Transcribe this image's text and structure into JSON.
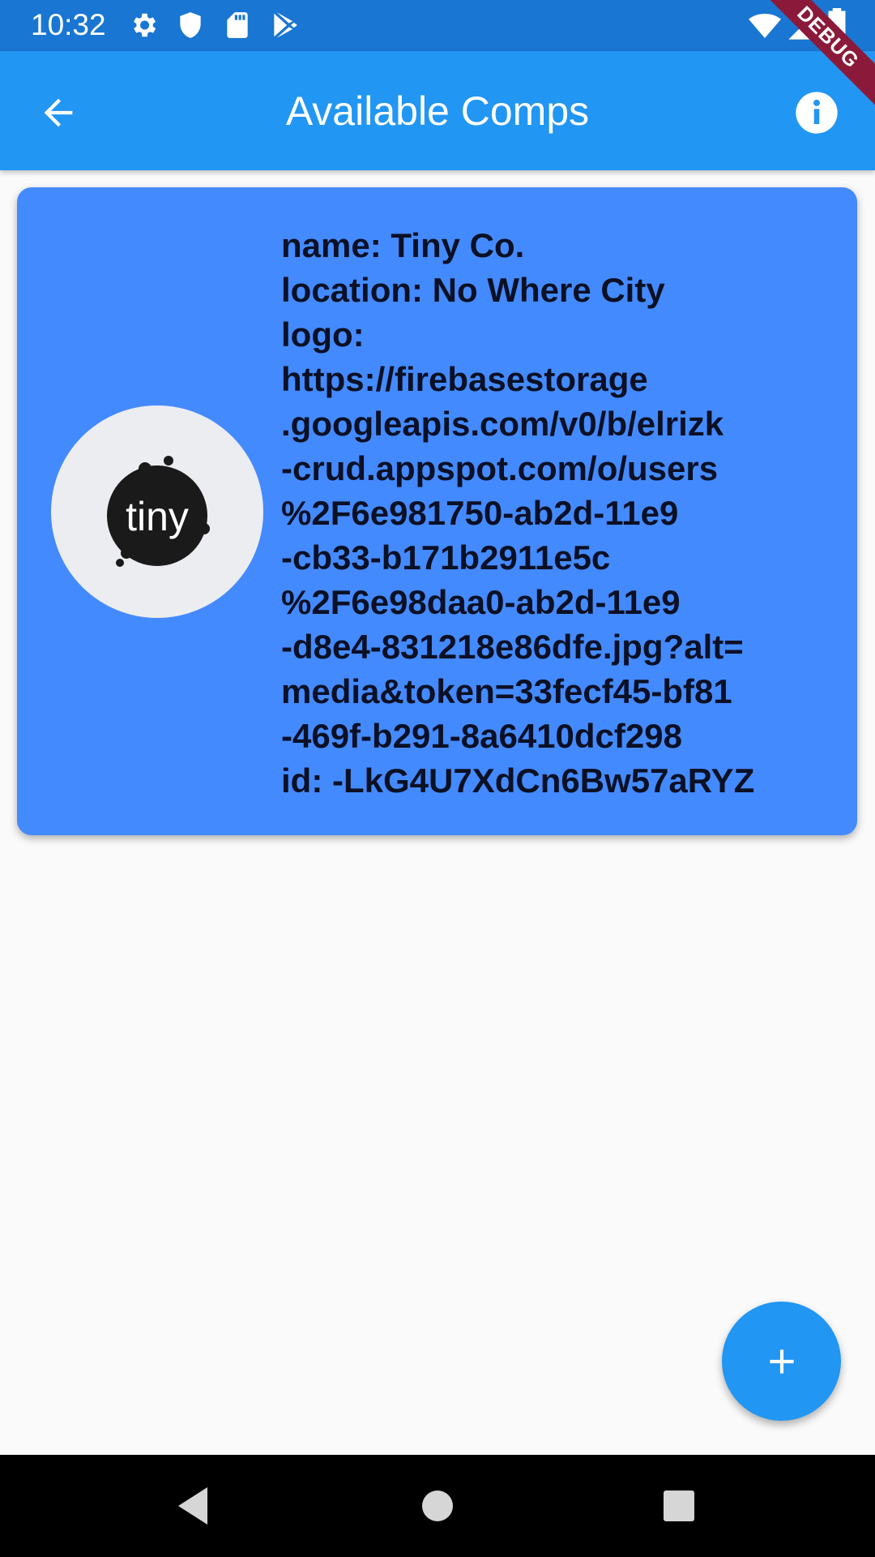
{
  "status_bar": {
    "time": "10:32",
    "icons": [
      "gear-icon",
      "shield-icon",
      "sd-card-icon",
      "play-store-icon",
      "wifi-icon",
      "signal-icon",
      "battery-icon"
    ]
  },
  "app_bar": {
    "title": "Available Comps",
    "back_icon": "arrow-back-icon",
    "info_icon": "info-icon",
    "color": "#2196f3"
  },
  "debug_banner": {
    "label": "DEBUG"
  },
  "card": {
    "color": "#448aff",
    "logo_text": "tiny",
    "lines": [
      "name: Tiny Co.",
      "location: No Where City",
      "logo:",
      "https://firebasestorage",
      ".googleapis.com/v0/b/elrizk",
      "-crud.appspot.com/o/users",
      "%2F6e981750-ab2d-11e9",
      "-cb33-b171b2911e5c",
      "%2F6e98daa0-ab2d-11e9",
      "-d8e4-831218e86dfe.jpg?alt=",
      "media&token=33fecf45-bf81",
      "-469f-b291-8a6410dcf298",
      "id: -LkG4U7XdCn6Bw57aRYZ"
    ]
  },
  "fab": {
    "icon": "add-icon",
    "color": "#2196f3"
  },
  "nav_bar": {
    "buttons": [
      "back-triangle-icon",
      "home-circle-icon",
      "recents-square-icon"
    ]
  }
}
